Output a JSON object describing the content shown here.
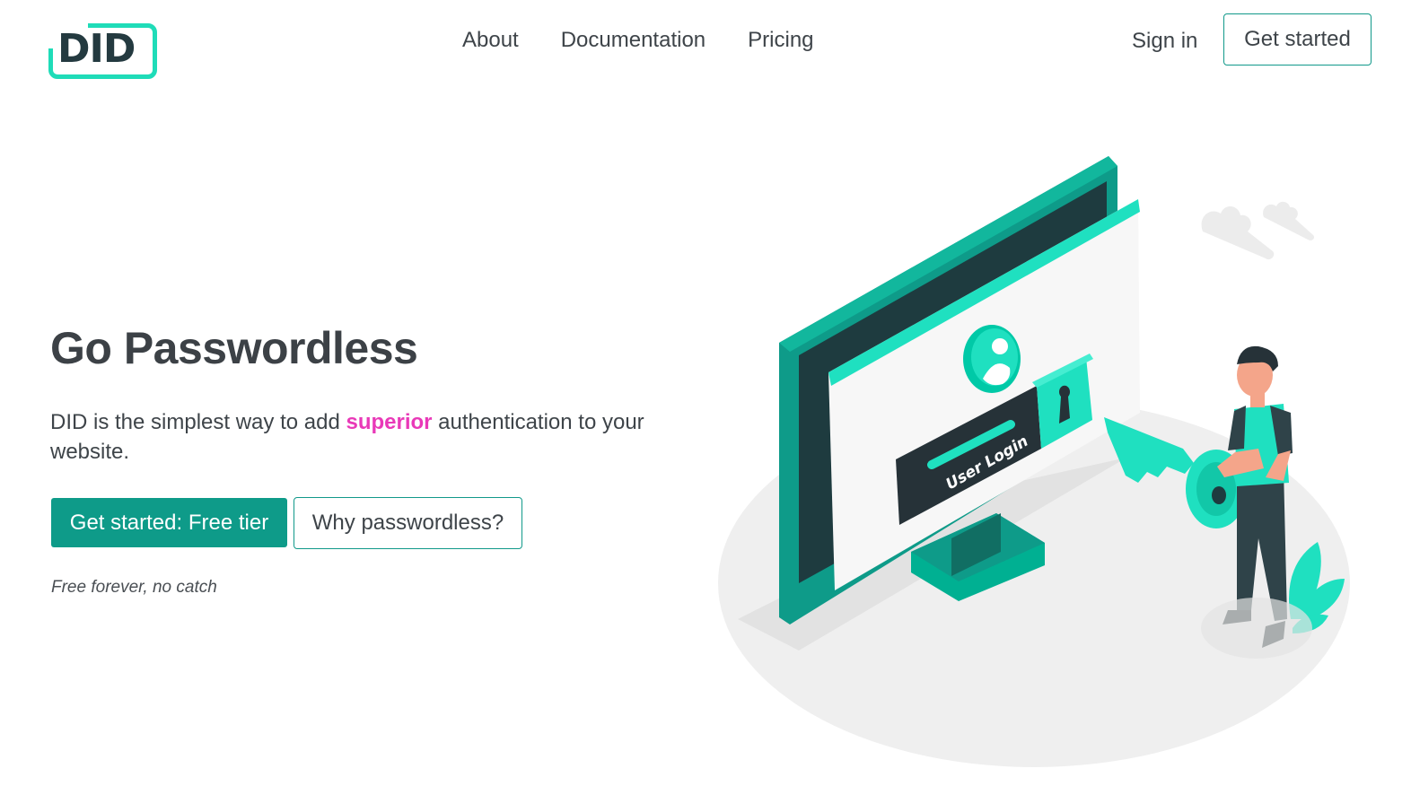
{
  "brand": {
    "logo_text": "DID",
    "accent": "#1fdcb8",
    "dark": "#243a40"
  },
  "nav": {
    "links": [
      "About",
      "Documentation",
      "Pricing"
    ],
    "signin": "Sign in",
    "cta": "Get started"
  },
  "hero": {
    "title": "Go Passwordless",
    "desc_before": "DID is the simplest way to add ",
    "desc_highlight": "superior",
    "desc_after": " authentication to your website.",
    "primary_button": "Get started: Free tier",
    "secondary_button": "Why passwordless?",
    "note": "Free forever, no catch"
  },
  "illustration": {
    "login_label": "User Login",
    "colors": {
      "teal": "#0e9b89",
      "mint": "#1fe0c0",
      "dark": "#263238",
      "floor": "#efefef"
    }
  }
}
